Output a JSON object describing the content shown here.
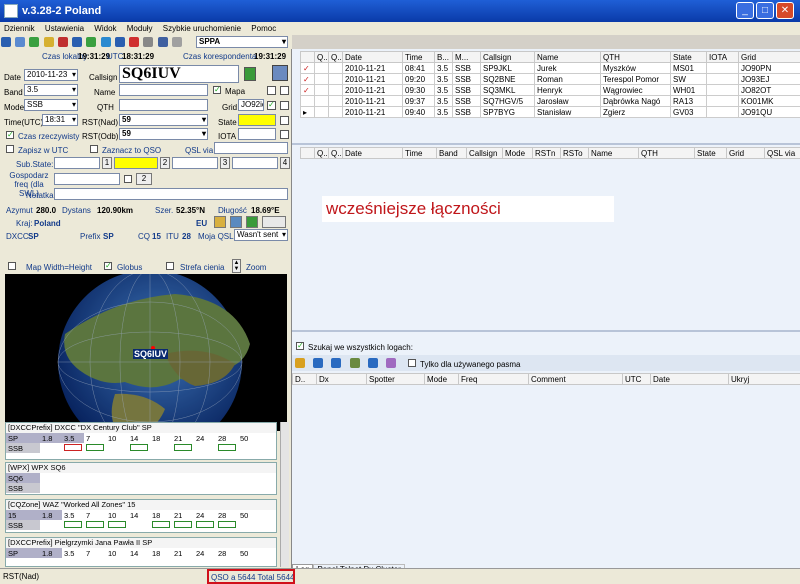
{
  "window": {
    "title": "v.3.28-2 Poland"
  },
  "menu": [
    "Dziennik",
    "Ustawienia",
    "Widok",
    "Moduły",
    "Szybkie uruchomienie",
    "Pomoc"
  ],
  "toolbar": {
    "profile": "SPPA"
  },
  "times": {
    "local_label": "Czas lokalny",
    "local_value": "19:31:29",
    "utc_label": "UTC",
    "utc_value": "18:31:29",
    "corr_label": "Czas korespondenta",
    "corr_value": "19:31:29"
  },
  "form": {
    "date_label": "Date",
    "date": "2010-11-23",
    "callsign_label": "Callsign",
    "callsign": "SQ6IUV",
    "band_label": "Band",
    "band": "3.5",
    "name_label": "Name",
    "mapa_label": "Mapa",
    "mode_label": "Mode",
    "mode": "SSB",
    "qth_label": "QTH",
    "grid_label": "Grid",
    "grid": "JO92ic",
    "time_label": "Time(UTC)",
    "time": "18:31",
    "rst_sent_label": "RST(Nad)",
    "rst_sent": "59",
    "state_label": "State",
    "real_time_label": "Czas rzeczywisty",
    "rst_rcvd_label": "RST(Odb)",
    "rst_rcvd": "59",
    "iota_label": "IOTA",
    "save_utc_label": "Zapisz w UTC",
    "mark_qso_label": "Zaznacz to QSO",
    "qsl_via_label": "QSL via",
    "substate_label": "Sub.State:",
    "gospodarz_label": "Gospodarz freq (dla SWL)",
    "gospodarz_btn": "2",
    "notatka_label": "Notatka",
    "num_buttons": [
      "1",
      "2",
      "3",
      "4"
    ]
  },
  "info": {
    "azimuth_label": "Azymut",
    "azimuth": "280.0",
    "distance_label": "Dystans",
    "distance": "120.90km",
    "lat_label": "Szer.",
    "lat": "52.35°N",
    "lon_label": "Długość",
    "lon": "18.69°E",
    "country_label": "Kraj:",
    "country": "Poland",
    "continent": "EU",
    "dxcc_label": "DXCC",
    "dxcc": "SP",
    "prefix_label": "Prefix",
    "prefix": "SP",
    "cq_label": "CQ",
    "cq": "15",
    "itu_label": "ITU",
    "itu": "28",
    "myqsl_label": "Moja QSL",
    "myqsl": "Wasn't sent"
  },
  "map_options": {
    "width_height": "Map Width=Height",
    "globus": "Globus",
    "strefa": "Strefa cienia",
    "zoom": "Zoom",
    "marker": "SQ6IUV"
  },
  "awards": [
    {
      "title": "[DXCCPrefix] DXCC \"DX Century Club\" SP",
      "bands": [
        "1.8",
        "3.5",
        "7",
        "10",
        "14",
        "18",
        "21",
        "24",
        "28",
        "50"
      ],
      "rows": [
        {
          "label": "SP",
          "cells": [
            0,
            2,
            3,
            0,
            1,
            0,
            1,
            0,
            3,
            0
          ]
        },
        {
          "label": "SSB",
          "cells": []
        }
      ]
    },
    {
      "title": "[WPX] WPX SQ6",
      "bands": [],
      "rows": [
        {
          "label": "SQ6",
          "cells": []
        },
        {
          "label": "SSB",
          "cells": []
        }
      ]
    },
    {
      "title": "[CQZone] WAZ \"Worked All Zones\" 15",
      "bands": [
        "1.8",
        "3.5",
        "7",
        "10",
        "14",
        "18",
        "21",
        "24",
        "28",
        "50"
      ],
      "rows": [
        {
          "label": "15",
          "cells": []
        },
        {
          "label": "SSB",
          "cells": [
            0,
            1,
            1,
            1,
            0,
            1,
            1,
            1,
            1,
            0
          ]
        }
      ]
    },
    {
      "title": "[DXCCPrefix] Pielgrzymki Jana Pawła II SP",
      "bands": [
        "1.8",
        "3.5",
        "7",
        "10",
        "14",
        "18",
        "21",
        "24",
        "28",
        "50"
      ],
      "rows": [
        {
          "label": "SP",
          "cells": []
        },
        {
          "label": "SSB",
          "cells": [
            0,
            1,
            1,
            0,
            0,
            1,
            0,
            0,
            1,
            0
          ]
        }
      ]
    }
  ],
  "log_table": {
    "headers": [
      "",
      "Q...",
      "Q...",
      "Date",
      "Time",
      "B...",
      "M...",
      "Callsign",
      "Name",
      "QTH",
      "State",
      "IOTA",
      "Grid"
    ],
    "rows": [
      [
        "✓",
        "",
        "",
        "2010-11-21",
        "08:41",
        "3.5",
        "SSB",
        "SP9JKL",
        "Jurek",
        "Myszków",
        "MS01",
        "",
        "JO90PN"
      ],
      [
        "✓",
        "",
        "",
        "2010-11-21",
        "09:20",
        "3.5",
        "SSB",
        "SQ2BNE",
        "Roman",
        "Terespol Pomor",
        "SW",
        "",
        "JO93EJ"
      ],
      [
        "✓",
        "",
        "",
        "2010-11-21",
        "09:30",
        "3.5",
        "SSB",
        "SQ3MKL",
        "Henryk",
        "Wągrowiec",
        "WH01",
        "",
        "JO82OT"
      ],
      [
        "",
        "",
        "",
        "2010-11-21",
        "09:37",
        "3.5",
        "SSB",
        "SQ7HGV/5",
        "Jarosław",
        "Dąbrówka Nagó",
        "RA13",
        "",
        "KO01MK"
      ],
      [
        "▸",
        "",
        "",
        "2010-11-21",
        "09:40",
        "3.5",
        "SSB",
        "SP7BYG",
        "Stanisław",
        "Zgierz",
        "GV03",
        "",
        "JO91QU"
      ]
    ]
  },
  "prev_table": {
    "headers": [
      "",
      "Q...",
      "Q...",
      "Date",
      "Time",
      "Band",
      "Callsign",
      "Mode",
      "RSTn",
      "RSTo",
      "Name",
      "QTH",
      "State",
      "Grid",
      "QSL via"
    ]
  },
  "prev_title": "wcześniejsze łączności",
  "search": {
    "all_logs": "Szukaj we wszystkich logach:",
    "band_only": "Tylko dla używanego pasma"
  },
  "cluster_table": {
    "headers": [
      "D..",
      "Dx",
      "Spotter",
      "Mode",
      "Freq",
      "Comment",
      "UTC",
      "Date",
      "Ukryj"
    ]
  },
  "tabs": [
    "Log",
    "Panel Telnet Dx Cluster"
  ],
  "status": {
    "left": "RST(Nad)",
    "qso": "QSO a 5644 Total 5644"
  }
}
